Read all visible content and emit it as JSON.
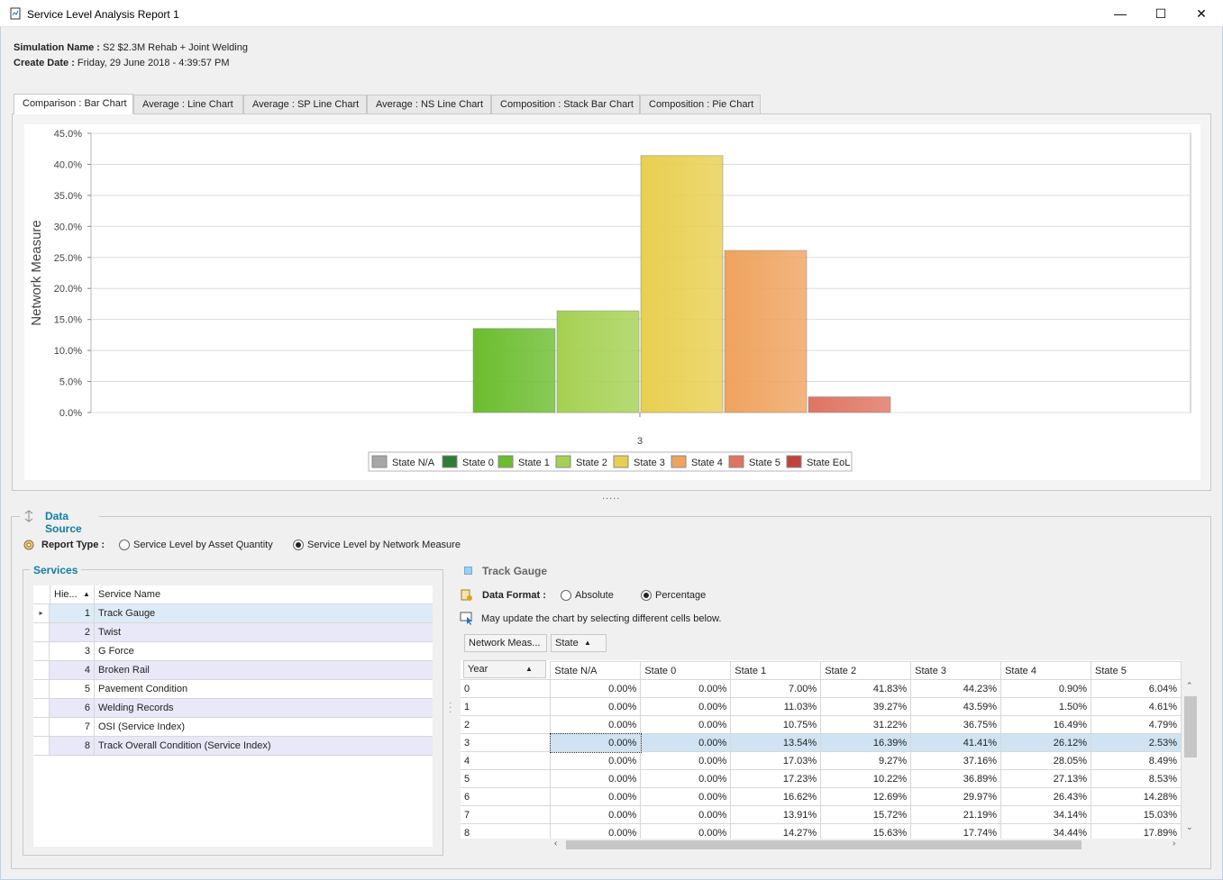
{
  "window": {
    "title": "Service Level Analysis Report 1",
    "minimize": "—",
    "maximize": "☐",
    "close": "✕"
  },
  "info": {
    "sim_label": "Simulation Name :",
    "sim_value": "S2 $2.3M Rehab + Joint Welding",
    "date_label": "Create Date :",
    "date_value": "Friday, 29 June 2018 - 4:39:57 PM"
  },
  "tabs": [
    {
      "label": "Comparison : Bar Chart"
    },
    {
      "label": "Average : Line Chart"
    },
    {
      "label": "Average : SP Line Chart"
    },
    {
      "label": "Average : NS Line Chart"
    },
    {
      "label": "Composition : Stack Bar Chart"
    },
    {
      "label": "Composition : Pie Chart"
    }
  ],
  "chart_data": {
    "type": "bar",
    "categories": [
      "3"
    ],
    "ylabel": "Network Measure",
    "xlabel": "",
    "ylim": [
      0,
      45
    ],
    "yticks": [
      "0.0%",
      "5.0%",
      "10.0%",
      "15.0%",
      "20.0%",
      "25.0%",
      "30.0%",
      "35.0%",
      "40.0%",
      "45.0%"
    ],
    "grid": true,
    "legend_position": "bottom",
    "series": [
      {
        "name": "State N/A",
        "values": [
          0.0
        ],
        "color": "#a6a6a6"
      },
      {
        "name": "State 0",
        "values": [
          0.0
        ],
        "color": "#2e7d32"
      },
      {
        "name": "State 1",
        "values": [
          13.54
        ],
        "color": "#6bbd2e"
      },
      {
        "name": "State 2",
        "values": [
          16.39
        ],
        "color": "#a5d152"
      },
      {
        "name": "State 3",
        "values": [
          41.41
        ],
        "color": "#e8cf4f"
      },
      {
        "name": "State 4",
        "values": [
          26.12
        ],
        "color": "#efa35e"
      },
      {
        "name": "State 5",
        "values": [
          2.53
        ],
        "color": "#df7461"
      },
      {
        "name": "State EoL",
        "values": [
          0.0
        ],
        "color": "#c0443a"
      }
    ]
  },
  "splitter": ".....",
  "datasource": {
    "title": "Data Source",
    "report_type_label": "Report Type :",
    "option_asset": "Service Level by Asset Quantity",
    "option_network": "Service Level by Network Measure",
    "selected": "network"
  },
  "services": {
    "title": "Services",
    "col_hier": "Hie...",
    "col_name": "Service Name",
    "rows": [
      {
        "num": "1",
        "name": "Track Gauge"
      },
      {
        "num": "2",
        "name": "Twist"
      },
      {
        "num": "3",
        "name": "G Force"
      },
      {
        "num": "4",
        "name": "Broken Rail"
      },
      {
        "num": "5",
        "name": "Pavement Condition"
      },
      {
        "num": "6",
        "name": "Welding Records"
      },
      {
        "num": "7",
        "name": "OSI (Service Index)"
      },
      {
        "num": "8",
        "name": "Track Overall Condition (Service Index)"
      }
    ]
  },
  "detail": {
    "title": "Track Gauge",
    "format_label": "Data Format :",
    "opt_absolute": "Absolute",
    "opt_percentage": "Percentage",
    "hint": "May update the chart by selecting different cells below.",
    "filter_measure": "Network Meas...",
    "filter_state": "State",
    "col_year": "Year",
    "columns": [
      "State N/A",
      "State 0",
      "State 1",
      "State 2",
      "State 3",
      "State 4",
      "State 5"
    ],
    "rows": [
      {
        "year": "0",
        "vals": [
          "0.00%",
          "0.00%",
          "7.00%",
          "41.83%",
          "44.23%",
          "0.90%",
          "6.04%"
        ]
      },
      {
        "year": "1",
        "vals": [
          "0.00%",
          "0.00%",
          "11.03%",
          "39.27%",
          "43.59%",
          "1.50%",
          "4.61%"
        ]
      },
      {
        "year": "2",
        "vals": [
          "0.00%",
          "0.00%",
          "10.75%",
          "31.22%",
          "36.75%",
          "16.49%",
          "4.79%"
        ]
      },
      {
        "year": "3",
        "vals": [
          "0.00%",
          "0.00%",
          "13.54%",
          "16.39%",
          "41.41%",
          "26.12%",
          "2.53%"
        ]
      },
      {
        "year": "4",
        "vals": [
          "0.00%",
          "0.00%",
          "17.03%",
          "9.27%",
          "37.16%",
          "28.05%",
          "8.49%"
        ]
      },
      {
        "year": "5",
        "vals": [
          "0.00%",
          "0.00%",
          "17.23%",
          "10.22%",
          "36.89%",
          "27.13%",
          "8.53%"
        ]
      },
      {
        "year": "6",
        "vals": [
          "0.00%",
          "0.00%",
          "16.62%",
          "12.69%",
          "29.97%",
          "26.43%",
          "14.28%"
        ]
      },
      {
        "year": "7",
        "vals": [
          "0.00%",
          "0.00%",
          "13.91%",
          "15.72%",
          "21.19%",
          "34.14%",
          "15.03%"
        ]
      },
      {
        "year": "8",
        "vals": [
          "0.00%",
          "0.00%",
          "14.27%",
          "15.63%",
          "17.74%",
          "34.44%",
          "17.89%"
        ]
      }
    ]
  }
}
